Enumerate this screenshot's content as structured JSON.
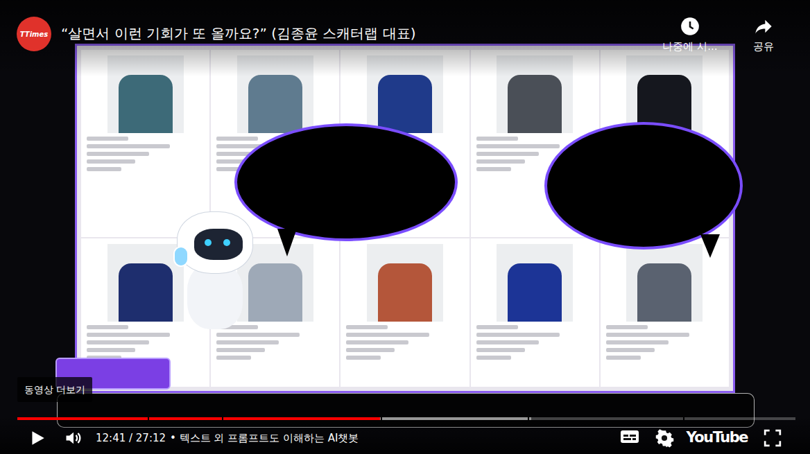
{
  "channel": {
    "logo_text": "TTimes"
  },
  "title": "“살면서 이런 기회가 또 올까요?” (김종윤 스캐터랩 대표)",
  "top_actions": [
    {
      "label": "나중에 시...",
      "kind": "watch-later"
    },
    {
      "label": "공유",
      "kind": "share"
    }
  ],
  "more_videos": "동영상 더보기",
  "progress": {
    "level": 0.466,
    "buffered": 0.66,
    "chapter_breaks": [
      0.168,
      0.263,
      0.467,
      0.656,
      0.856
    ]
  },
  "player": {
    "playing": false,
    "captions_on": false
  },
  "time": "12:41 / 27:12",
  "chapter": "• 텍스트 외 프롬프트도 이해하는 AI챗봇",
  "brand": "YouTube"
}
